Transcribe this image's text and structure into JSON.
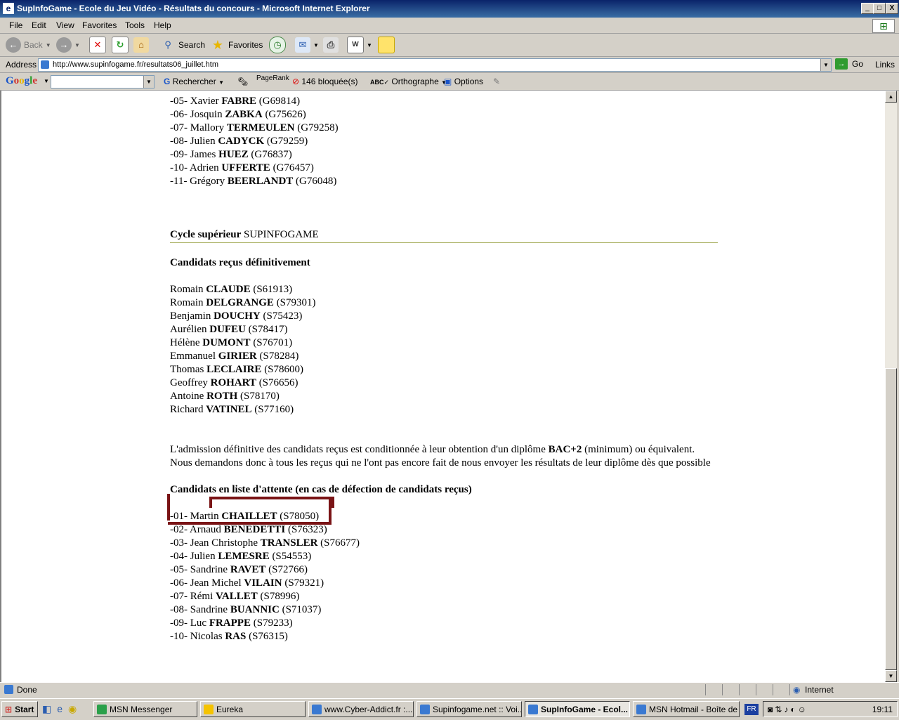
{
  "window": {
    "title": "SupInfoGame - Ecole du Jeu Vidéo - Résultats du concours - Microsoft Internet Explorer",
    "controls": [
      "_",
      "□",
      "X"
    ]
  },
  "menu": [
    "File",
    "Edit",
    "View",
    "Favorites",
    "Tools",
    "Help"
  ],
  "toolbar": {
    "back": "Back",
    "search": "Search",
    "favorites": "Favorites"
  },
  "address": {
    "label": "Address",
    "url": "http://www.supinfogame.fr/resultats06_juillet.htm",
    "go": "Go",
    "links": "Links"
  },
  "googlebar": {
    "logo": "Google",
    "search_value": "",
    "rechercher": "Rechercher",
    "pagerank": "PageRank",
    "blocked": "146 bloquée(s)",
    "orthographe": "Orthographe",
    "options": "Options"
  },
  "document": {
    "list1": [
      {
        "prefix": "-05- Xavier ",
        "last": "FABRE",
        "id": " (G69814)"
      },
      {
        "prefix": "-06- Josquin ",
        "last": "ZABKA",
        "id": " (G75626)"
      },
      {
        "prefix": "-07- Mallory ",
        "last": "TERMEULEN",
        "id": " (G79258)"
      },
      {
        "prefix": "-08- Julien ",
        "last": "CADYCK",
        "id": " (G79259)"
      },
      {
        "prefix": "-09- James ",
        "last": "HUEZ",
        "id": " (G76837)"
      },
      {
        "prefix": "-10- Adrien ",
        "last": "UFFERTE",
        "id": " (G76457)"
      },
      {
        "prefix": "-11- Grégory ",
        "last": "BEERLANDT",
        "id": " (G76048)"
      }
    ],
    "section_title_bold": "Cycle supérieur",
    "section_title_rest": " SUPINFOGAME",
    "accepted_heading": "Candidats reçus définitivement",
    "accepted": [
      {
        "prefix": "Romain ",
        "last": "CLAUDE",
        "id": " (S61913)"
      },
      {
        "prefix": "Romain ",
        "last": "DELGRANGE",
        "id": " (S79301)"
      },
      {
        "prefix": "Benjamin ",
        "last": "DOUCHY",
        "id": " (S75423)"
      },
      {
        "prefix": "Aurélien ",
        "last": "DUFEU",
        "id": " (S78417)"
      },
      {
        "prefix": "Hélène ",
        "last": "DUMONT",
        "id": " (S76701)"
      },
      {
        "prefix": "Emmanuel ",
        "last": "GIRIER",
        "id": " (S78284)"
      },
      {
        "prefix": "Thomas ",
        "last": "LECLAIRE",
        "id": " (S78600)"
      },
      {
        "prefix": "Geoffrey ",
        "last": "ROHART",
        "id": " (S76656)"
      },
      {
        "prefix": "Antoine ",
        "last": "ROTH",
        "id": " (S78170)"
      },
      {
        "prefix": "Richard ",
        "last": "VATINEL",
        "id": " (S77160)"
      }
    ],
    "note1_a": "L'admission définitive des candidats reçus est conditionnée à leur obtention d'un diplôme ",
    "note1_b": "BAC+2",
    "note1_c": " (minimum) ou équivalent.",
    "note2": "Nous demandons donc à tous les reçus qui ne l'ont pas encore fait de nous envoyer les résultats de leur diplôme dès que possible",
    "waitlist_heading": "Candidats en liste d'attente (en cas de défection de candidats reçus)",
    "waitlist": [
      {
        "prefix": "-01- Martin ",
        "last": "CHAILLET",
        "id": " (S78050)"
      },
      {
        "prefix": "-02- Arnaud ",
        "last": "BENEDETTI",
        "id": " (S76323)"
      },
      {
        "prefix": "-03- Jean Christophe ",
        "last": "TRANSLER",
        "id": " (S76677)"
      },
      {
        "prefix": "-04- Julien ",
        "last": "LEMESRE",
        "id": " (S54553)"
      },
      {
        "prefix": "-05- Sandrine ",
        "last": "RAVET",
        "id": " (S72766)"
      },
      {
        "prefix": "-06- Jean Michel ",
        "last": "VILAIN",
        "id": " (S79321)"
      },
      {
        "prefix": "-07- Rémi ",
        "last": "VALLET",
        "id": " (S78996)"
      },
      {
        "prefix": "-08- Sandrine ",
        "last": "BUANNIC",
        "id": " (S71037)"
      },
      {
        "prefix": "-09- Luc ",
        "last": "FRAPPE",
        "id": " (S79233)"
      },
      {
        "prefix": "-10- Nicolas ",
        "last": "RAS",
        "id": " (S76315)"
      }
    ]
  },
  "status": {
    "text": "Done",
    "zone": "Internet"
  },
  "taskbar": {
    "start": "Start",
    "tasks": [
      {
        "label": "MSN Messenger",
        "active": false
      },
      {
        "label": "Eureka",
        "active": false
      },
      {
        "label": "www.Cyber-Addict.fr :...",
        "active": false
      },
      {
        "label": "Supinfogame.net :: Voi...",
        "active": false
      },
      {
        "label": "SupInfoGame - Ecol...",
        "active": true
      },
      {
        "label": "MSN Hotmail - Boîte de ...",
        "active": false
      }
    ],
    "lang": "FR",
    "clock": "19:11"
  },
  "colors": {
    "highlight_mark": "#7a1416",
    "title_bar": "#0a246a"
  }
}
